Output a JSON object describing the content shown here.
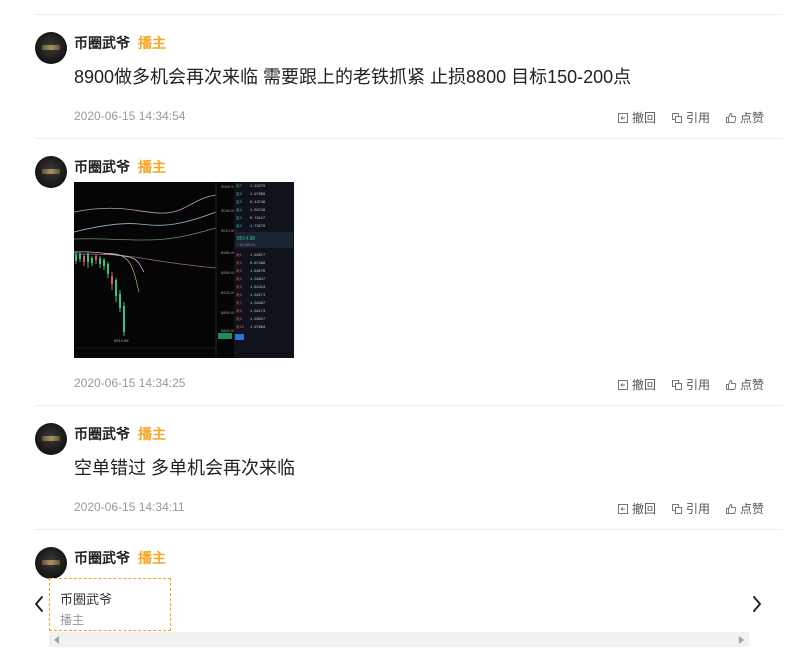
{
  "posts": [
    {
      "author": "币圈武爷",
      "role": "播主",
      "content": "8900做多机会再次来临 需要跟上的老铁抓紧 止损8800 目标150-200点",
      "time": "2020-06-15 14:34:54",
      "actions": {
        "revoke": "撤回",
        "quote": "引用",
        "like": "点赞"
      }
    },
    {
      "author": "币圈武爷",
      "role": "播主",
      "content": "",
      "time": "2020-06-15 14:34:25",
      "actions": {
        "revoke": "撤回",
        "quote": "引用",
        "like": "点赞"
      }
    },
    {
      "author": "币圈武爷",
      "role": "播主",
      "content": "空单错过 多单机会再次来临",
      "time": "2020-06-15 14:34:11",
      "actions": {
        "revoke": "撤回",
        "quote": "引用",
        "like": "点赞"
      }
    },
    {
      "author": "币圈武爷",
      "role": "播主"
    }
  ],
  "speaker": {
    "name": "币圈武爷",
    "role": "播主"
  },
  "icons": {
    "prev": "chevron-left-icon",
    "next": "chevron-right-icon",
    "revoke": "revoke-icon",
    "quote": "quote-icon",
    "like": "thumbs-up-icon"
  },
  "colors": {
    "role": "#f5a623",
    "text": "#222222",
    "muted": "#999999",
    "divider": "#eeeeee"
  }
}
